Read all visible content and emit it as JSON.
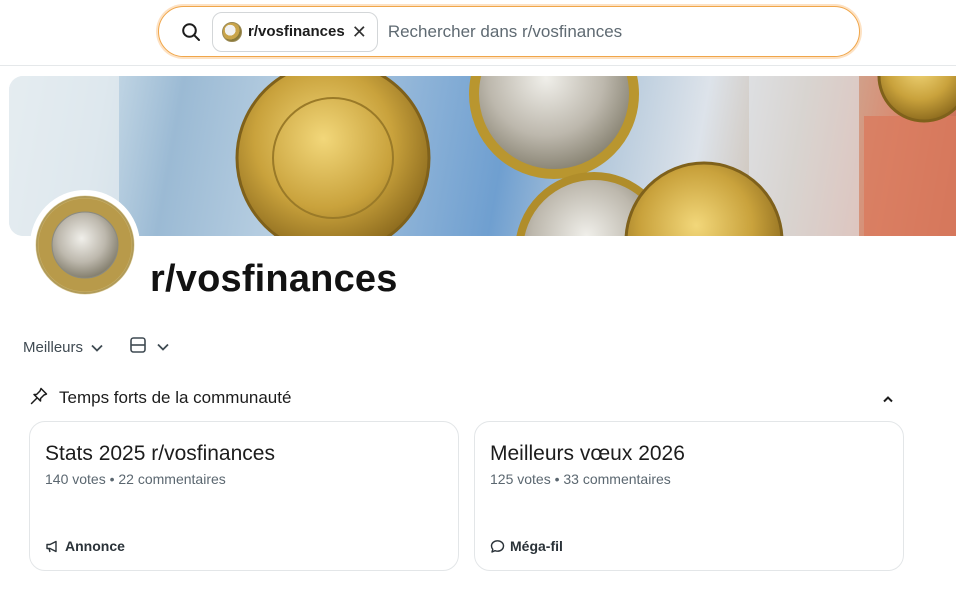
{
  "search": {
    "chip_label": "r/vosfinances",
    "placeholder": "Rechercher dans r/vosfinances"
  },
  "community": {
    "name": "r/vosfinances"
  },
  "sort": {
    "selected": "Meilleurs"
  },
  "highlights": {
    "title": "Temps forts de la communauté",
    "cards": [
      {
        "title": "Stats 2025 r/vosfinances",
        "meta": "140 votes • 22 commentaires",
        "tag": "Annonce",
        "tag_icon": "megaphone-icon"
      },
      {
        "title": "Meilleurs vœux 2026",
        "meta": "125 votes • 33 commentaires",
        "tag": "Méga-fil",
        "tag_icon": "speech-bubble-icon"
      }
    ]
  },
  "colors": {
    "search_border": "#f0a64a",
    "text_primary": "#1c1c1c",
    "text_secondary": "#5b6770"
  }
}
